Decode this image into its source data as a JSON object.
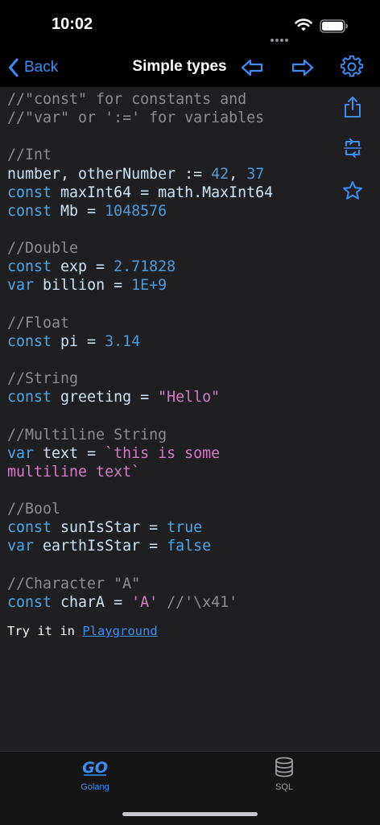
{
  "status_bar": {
    "time": "10:02"
  },
  "nav": {
    "back_label": "Back",
    "title": "Simple types"
  },
  "code_lines": [
    [
      [
        "com",
        "//\"const\" for constants and"
      ]
    ],
    [
      [
        "com",
        "//\"var\" or ':=' for variables"
      ]
    ],
    [],
    [
      [
        "com",
        "//Int"
      ]
    ],
    [
      [
        "id",
        "number, otherNumber := "
      ],
      [
        "num",
        "42"
      ],
      [
        "id",
        ", "
      ],
      [
        "num",
        "37"
      ]
    ],
    [
      [
        "kw",
        "const"
      ],
      [
        "id",
        " maxInt64 = math.MaxInt64"
      ]
    ],
    [
      [
        "kw",
        "const"
      ],
      [
        "id",
        " Mb = "
      ],
      [
        "num",
        "1048576"
      ]
    ],
    [],
    [
      [
        "com",
        "//Double"
      ]
    ],
    [
      [
        "kw",
        "const"
      ],
      [
        "id",
        " exp = "
      ],
      [
        "num",
        "2.71828"
      ]
    ],
    [
      [
        "kw",
        "var"
      ],
      [
        "id",
        " billion = "
      ],
      [
        "num",
        "1E+9"
      ]
    ],
    [],
    [
      [
        "com",
        "//Float"
      ]
    ],
    [
      [
        "kw",
        "const"
      ],
      [
        "id",
        " pi = "
      ],
      [
        "num",
        "3.14"
      ]
    ],
    [],
    [
      [
        "com",
        "//String"
      ]
    ],
    [
      [
        "kw",
        "const"
      ],
      [
        "id",
        " greeting = "
      ],
      [
        "str",
        "\"Hello\""
      ]
    ],
    [],
    [
      [
        "com",
        "//Multiline String"
      ]
    ],
    [
      [
        "kw",
        "var"
      ],
      [
        "id",
        " text = "
      ],
      [
        "str",
        "`this is some"
      ]
    ],
    [
      [
        "str",
        "multiline text`"
      ]
    ],
    [],
    [
      [
        "com",
        "//Bool"
      ]
    ],
    [
      [
        "kw",
        "const"
      ],
      [
        "id",
        " sunIsStar = "
      ],
      [
        "kw",
        "true"
      ]
    ],
    [
      [
        "kw",
        "var"
      ],
      [
        "id",
        " earthIsStar = "
      ],
      [
        "kw",
        "false"
      ]
    ],
    [],
    [
      [
        "com",
        "//Character \"A\""
      ]
    ],
    [
      [
        "kw",
        "const"
      ],
      [
        "id",
        " charA = "
      ],
      [
        "str",
        "'A'"
      ],
      [
        "com",
        " //'\\x41'"
      ]
    ]
  ],
  "playground": {
    "prefix": "Try it in ",
    "link": "Playground"
  },
  "tabs": [
    {
      "label": "Golang",
      "color": "#3a8ef6"
    },
    {
      "label": "SQL",
      "color": "#9a9a9f"
    }
  ],
  "colors": {
    "accent": "#3a8ef6",
    "background": "#1f1f21"
  }
}
